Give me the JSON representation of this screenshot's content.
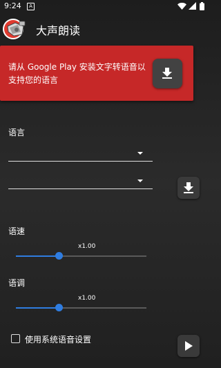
{
  "status_bar": {
    "time": "9:24",
    "notification_icon": "notification-a-icon",
    "wifi_icon": "wifi-icon",
    "signal_icon": "signal-icon",
    "battery_icon": "battery-icon"
  },
  "app_bar": {
    "title": "大声朗读",
    "logo_icon": "megaphone-logo-icon"
  },
  "banner": {
    "text": "请从 Google Play 安装文字转语音以支持您的语言",
    "download_icon": "download-icon",
    "bg_color": "#c62828"
  },
  "language": {
    "label": "语言",
    "dropdown1_value": "",
    "dropdown2_value": "",
    "download_icon": "download-icon"
  },
  "speed": {
    "label": "语速",
    "value_text": "x1.00",
    "level": 0.33
  },
  "pitch": {
    "label": "语调",
    "value_text": "x1.00",
    "level": 0.33
  },
  "system_settings": {
    "label": "使用系统语音设置",
    "checked": false
  },
  "play_icon": "play-icon",
  "accent_color": "#2f7de1"
}
